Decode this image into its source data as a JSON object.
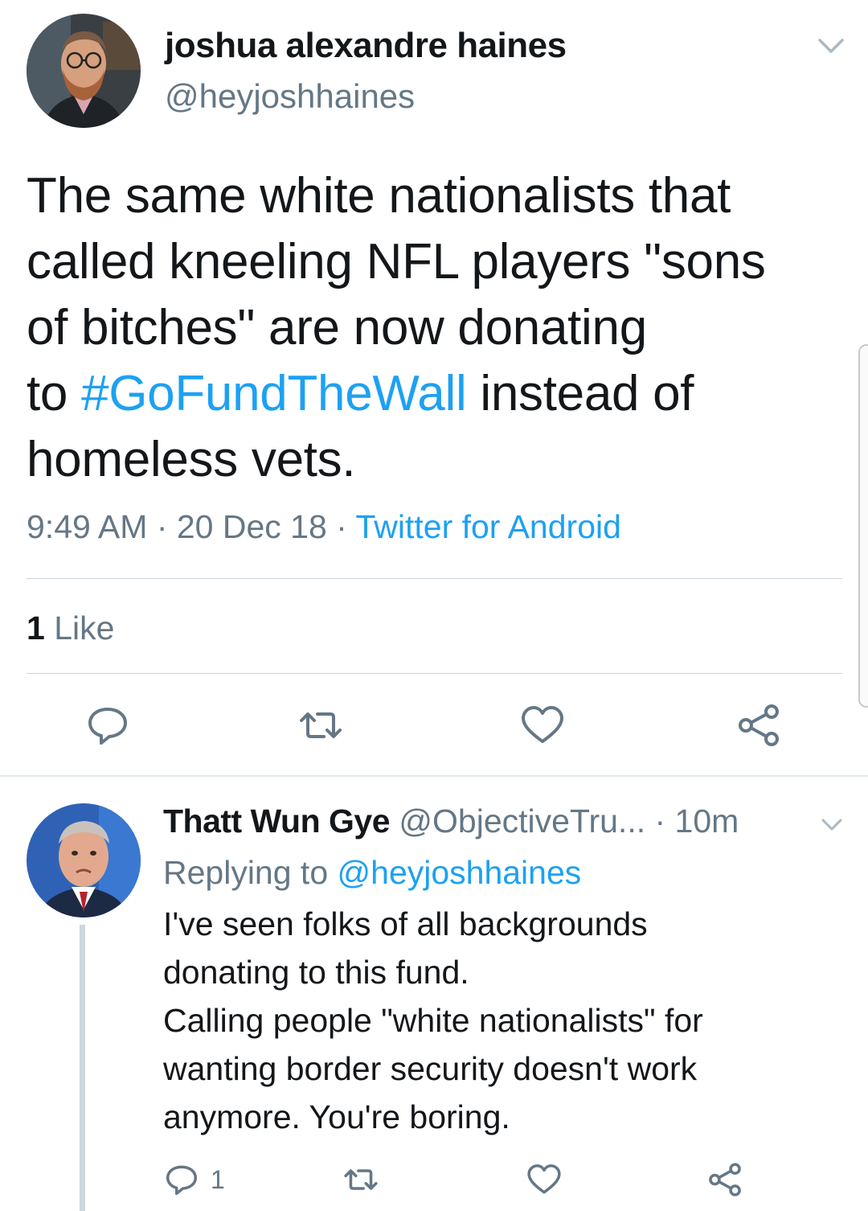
{
  "main_tweet": {
    "author_name": "joshua alexandre haines",
    "author_handle": "@heyjoshhaines",
    "text_lines": [
      "The same white nationalists that",
      "called kneeling NFL players \"sons",
      "of bitches\" are now donating"
    ],
    "text_line4_prefix": "to ",
    "hashtag": "#GoFundTheWall",
    "text_line4_suffix": " instead of",
    "text_line5": "homeless vets.",
    "time": "9:49 AM",
    "separator": " · ",
    "date": "20 Dec 18",
    "source": "Twitter for Android",
    "like_count": "1",
    "like_label": " Like",
    "actions": [
      "reply-icon",
      "retweet-icon",
      "like-icon",
      "share-icon"
    ]
  },
  "reply_tweet": {
    "author_name": "Thatt Wun Gye",
    "author_handle": " @ObjectiveTru...",
    "time": " · 10m",
    "replying_prefix": "Replying to ",
    "replying_mention": "@heyjoshhaines",
    "text_lines": [
      "I've seen folks of all backgrounds",
      "donating to this fund.",
      "Calling people \"white nationalists\" for",
      "wanting border security doesn't work",
      "anymore. You're boring."
    ],
    "reply_count": "1"
  },
  "colors": {
    "link": "#1da1f2",
    "secondary_text": "#657786",
    "primary_text": "#14171a",
    "divider": "#ccd6dd"
  }
}
